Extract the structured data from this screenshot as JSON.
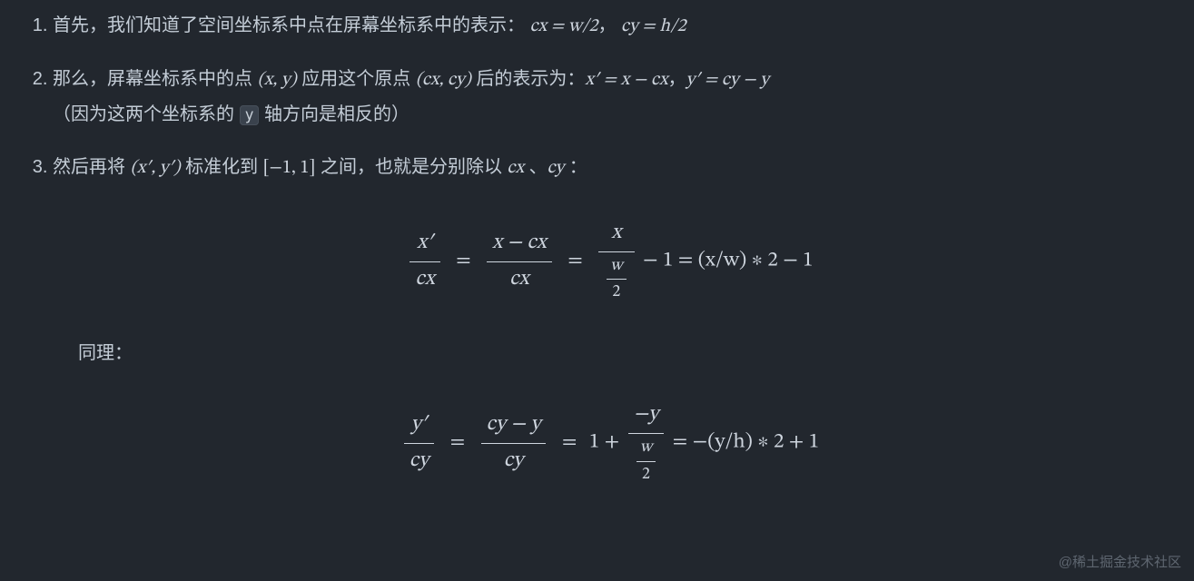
{
  "list": {
    "item1": {
      "t1": "首先，我们知道了空间坐标系中点在屏幕坐标系中的表示：",
      "math_a": "cx = w/2",
      "sep": "，",
      "math_b": "cy = h/2"
    },
    "item2": {
      "t1": "那么，屏幕坐标系中的点 ",
      "m1": "(x, y)",
      "t2": " 应用这个原点 ",
      "m2": "(cx, cy)",
      "t3": " 后的表示为：",
      "m3": "x′ = x − cx",
      "sep": "，",
      "m4": "y′ = cy − y",
      "line2a": "（因为这两个坐标系的 ",
      "code": "y",
      "line2b": " 轴方向是相反的）"
    },
    "item3": {
      "t1": "然后再将 ",
      "m1": "(x′, y′)",
      "t2": " 标准化到 ",
      "m2": "[−1, 1]",
      "t3": " 之间，也就是分别除以 ",
      "m3": "cx",
      "t4": " 、",
      "m4": "cy",
      "t5": " ："
    }
  },
  "formula1": {
    "f1n": "x′",
    "f1d": "cx",
    "f2n": "x − cx",
    "f2d": "cx",
    "f3n": "x",
    "f3dn": "w",
    "f3dd": "2",
    "tail": "− 1 = (x/w) ∗ 2 − 1"
  },
  "sameline": "同理：",
  "formula2": {
    "f1n": "y′",
    "f1d": "cy",
    "f2n": "cy − y",
    "f2d": "cy",
    "mid": "1 +",
    "f3n": "−y",
    "f3dn": "w",
    "f3dd": "2",
    "tail": "= −(y/h) ∗ 2 + 1"
  },
  "watermark": "@稀土掘金技术社区"
}
